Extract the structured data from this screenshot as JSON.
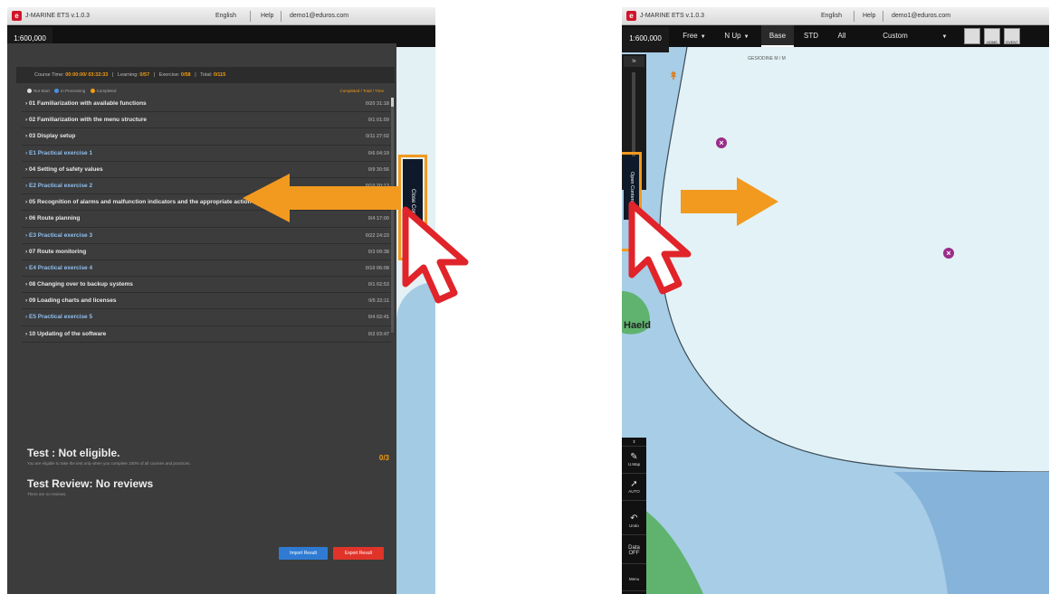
{
  "left": {
    "titlebar": {
      "app": "J-MARINE ETS v.1.0.3",
      "lang": "English",
      "help": "Help",
      "user": "demo1@eduros.com"
    },
    "scale": "1:600,000",
    "stats": {
      "course_time_label": "Course Time:",
      "course_time": "00:00:00/ 03:32:33",
      "learning_label": "Learning:",
      "learning": "0/57",
      "exercise_label": "Exercise:",
      "exercise": "0/58",
      "total_label": "Total:",
      "total": "0/115"
    },
    "legend": {
      "not_start": "Not Start",
      "in_progress": "In Processing",
      "completed": "Completed",
      "right": "Completed / Total / Time"
    },
    "courses": [
      {
        "title": "01 Familiarization with available functions",
        "time": "0/20  31:18",
        "exercise": false
      },
      {
        "title": "02 Familiarization with the menu structure",
        "time": "0/1  01:59",
        "exercise": false
      },
      {
        "title": "03 Display setup",
        "time": "0/11  27:02",
        "exercise": false
      },
      {
        "title": "E1 Practical exercise 1",
        "time": "0/6  04:19",
        "exercise": true
      },
      {
        "title": "04 Setting of safety values",
        "time": "0/9  30:56",
        "exercise": false
      },
      {
        "title": "E2 Practical exercise 2",
        "time": "0/10  20:13",
        "exercise": true
      },
      {
        "title": "05 Recognition of alarms and malfunction indicators and the appropriate action",
        "time": "0/7  14:07",
        "exercise": false
      },
      {
        "title": "06 Route planning",
        "time": "0/4  17:00",
        "exercise": false
      },
      {
        "title": "E3 Practical exercise 3",
        "time": "0/22  24:23",
        "exercise": true
      },
      {
        "title": "07 Route monitoring",
        "time": "0/3  09:38",
        "exercise": false
      },
      {
        "title": "E4 Practical exercise 4",
        "time": "0/10  06:08",
        "exercise": true
      },
      {
        "title": "08 Changing over to backup systems",
        "time": "0/1  02:53",
        "exercise": false
      },
      {
        "title": "09 Loading charts and licenses",
        "time": "0/5  22:11",
        "exercise": false
      },
      {
        "title": "E5 Practical exercise 5",
        "time": "0/4  02:41",
        "exercise": true
      },
      {
        "title": "10 Updating of the software",
        "time": "0/2  03:47",
        "exercise": false
      }
    ],
    "test": {
      "title": "Test : Not eligible.",
      "note": "You are eligible to take the test only when you complete 100% of all courses and practices.",
      "score": "0/3"
    },
    "review": {
      "title": "Test Review: No reviews",
      "note": "There are no reviews."
    },
    "import_label": "Import Result",
    "export_label": "Export Result",
    "close_label": "Close Contents"
  },
  "right": {
    "titlebar": {
      "app": "J-MARINE ETS v.1.0.3",
      "lang": "English",
      "help": "Help",
      "user": "demo1@eduros.com"
    },
    "scale": "1:600,000",
    "toolbar": {
      "free": "Free",
      "nup": "N Up",
      "base": "Base",
      "std": "STD",
      "all": "All",
      "custom": "Custom",
      "home": "HOME",
      "event": "EVENT"
    },
    "zoom_in": "In",
    "open_label": "Open Contents",
    "map_label": "GESIODINE\nM / M",
    "place_label": "Haeld",
    "tools": {
      "manual": "U.Map",
      "auto": "AUTO",
      "undo": "Undo",
      "data": "Data\nOFF",
      "menu": "Menu"
    }
  },
  "colors": {
    "accent_orange": "#f29a1f",
    "cursor_red": "#e0242a",
    "import_blue": "#2f7bd4",
    "export_red": "#e0342a"
  }
}
